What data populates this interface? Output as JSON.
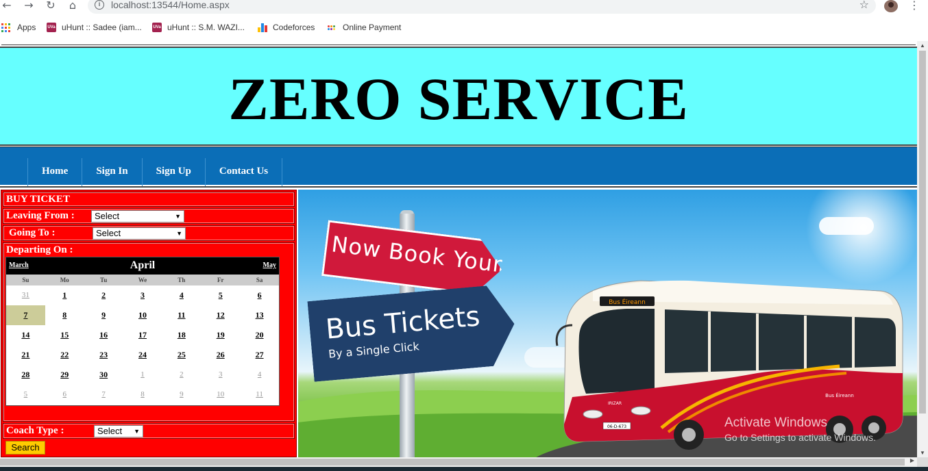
{
  "browser": {
    "url": "localhost:13544/Home.aspx",
    "bookmarks": [
      {
        "label": "Apps",
        "icon": "apps-grid-icon"
      },
      {
        "label": "uHunt :: Sadee (iam...",
        "icon": "uva-icon"
      },
      {
        "label": "uHunt :: S.M. WAZI...",
        "icon": "uva-icon"
      },
      {
        "label": "Codeforces",
        "icon": "codeforces-icon"
      },
      {
        "label": "Online Payment",
        "icon": "payment-icon"
      }
    ],
    "uva_badge": "UVa"
  },
  "site": {
    "title": "ZERO SERVICE",
    "header_color": "#66ffff",
    "menu_color": "#0b6eb7"
  },
  "menu": [
    {
      "label": "Home"
    },
    {
      "label": "Sign In"
    },
    {
      "label": "Sign Up"
    },
    {
      "label": "Contact Us"
    }
  ],
  "booking": {
    "heading": "BUY TICKET",
    "leaving_label": "Leaving From :",
    "leaving_value": "Select",
    "going_label": "Going To :",
    "going_value": "Select",
    "departing_label": "Departing On :",
    "coach_label": "Coach Type :",
    "coach_value": "Select",
    "search_label": "Search",
    "panel_color": "#ff0000",
    "button_color": "#ffcc00"
  },
  "calendar": {
    "prev_month": "March",
    "month": "April",
    "next_month": "May",
    "days_of_week": [
      "Su",
      "Mo",
      "Tu",
      "We",
      "Th",
      "Fr",
      "Sa"
    ],
    "selected": "7",
    "weeks": [
      [
        {
          "d": "31",
          "o": true
        },
        {
          "d": "1"
        },
        {
          "d": "2"
        },
        {
          "d": "3"
        },
        {
          "d": "4"
        },
        {
          "d": "5"
        },
        {
          "d": "6"
        }
      ],
      [
        {
          "d": "7",
          "s": true
        },
        {
          "d": "8"
        },
        {
          "d": "9"
        },
        {
          "d": "10"
        },
        {
          "d": "11"
        },
        {
          "d": "12"
        },
        {
          "d": "13"
        }
      ],
      [
        {
          "d": "14"
        },
        {
          "d": "15"
        },
        {
          "d": "16"
        },
        {
          "d": "17"
        },
        {
          "d": "18"
        },
        {
          "d": "19"
        },
        {
          "d": "20"
        }
      ],
      [
        {
          "d": "21"
        },
        {
          "d": "22"
        },
        {
          "d": "23"
        },
        {
          "d": "24"
        },
        {
          "d": "25"
        },
        {
          "d": "26"
        },
        {
          "d": "27"
        }
      ],
      [
        {
          "d": "28"
        },
        {
          "d": "29"
        },
        {
          "d": "30"
        },
        {
          "d": "1",
          "o": true
        },
        {
          "d": "2",
          "o": true
        },
        {
          "d": "3",
          "o": true
        },
        {
          "d": "4",
          "o": true
        }
      ],
      [
        {
          "d": "5",
          "o": true
        },
        {
          "d": "6",
          "o": true
        },
        {
          "d": "7",
          "o": true
        },
        {
          "d": "8",
          "o": true
        },
        {
          "d": "9",
          "o": true
        },
        {
          "d": "10",
          "o": true
        },
        {
          "d": "11",
          "o": true
        }
      ]
    ]
  },
  "banner": {
    "sign_top": "Now Book Your",
    "sign_main": "Bus Tickets",
    "sign_sub": "By a Single Click",
    "bus_destination": "Bus Éireann",
    "bus_brand": "Bus Éireann",
    "bus_plate": "06-D-673",
    "bus_model": "IRIZAR"
  },
  "watermark": {
    "line1": "Activate Windows",
    "line2": "Go to Settings to activate Windows."
  }
}
